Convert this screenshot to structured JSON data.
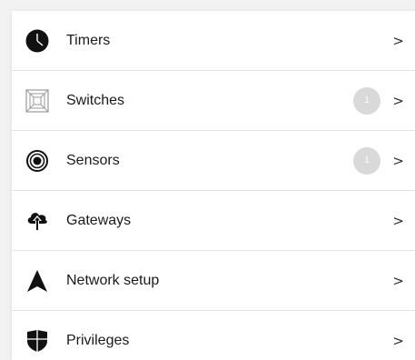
{
  "menu": {
    "items": [
      {
        "label": "Timers",
        "icon": "clock-icon",
        "badge": null
      },
      {
        "label": "Switches",
        "icon": "switch-icon",
        "badge": "1"
      },
      {
        "label": "Sensors",
        "icon": "sensor-icon",
        "badge": "1"
      },
      {
        "label": "Gateways",
        "icon": "gateway-icon",
        "badge": null
      },
      {
        "label": "Network setup",
        "icon": "network-icon",
        "badge": null
      },
      {
        "label": "Privileges",
        "icon": "shield-icon",
        "badge": null
      }
    ],
    "chevron": ">"
  },
  "colors": {
    "icon": "#111111",
    "badge_bg": "#d9d9d9",
    "divider": "#e3e3e3"
  }
}
